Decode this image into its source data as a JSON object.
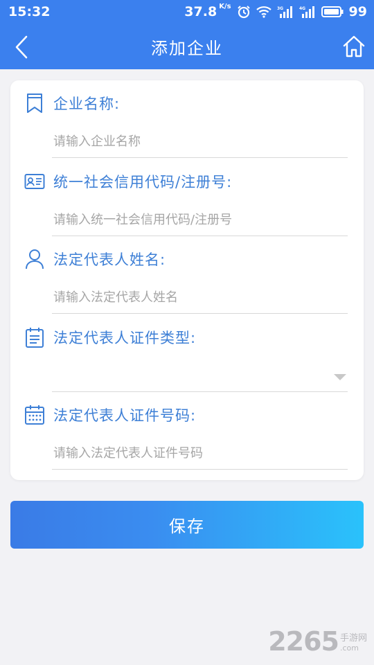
{
  "status_bar": {
    "time": "15:32",
    "net_speed": "37.8",
    "net_speed_unit": "K/s",
    "battery": "99",
    "icons": [
      "alarm-icon",
      "wifi-icon",
      "signal-3g-icon",
      "signal-4g-icon",
      "battery-icon"
    ]
  },
  "navbar": {
    "title": "添加企业",
    "back_icon": "chevron-left-icon",
    "home_icon": "home-icon"
  },
  "form": {
    "fields": [
      {
        "label": "企业名称:",
        "placeholder": "请输入企业名称",
        "icon": "bookmark-icon",
        "value": ""
      },
      {
        "label": "统一社会信用代码/注册号:",
        "placeholder": "请输入统一社会信用代码/注册号",
        "icon": "id-card-icon",
        "value": ""
      },
      {
        "label": "法定代表人姓名:",
        "placeholder": "请输入法定代表人姓名",
        "icon": "person-icon",
        "value": ""
      },
      {
        "label": "法定代表人证件类型:",
        "placeholder": "",
        "icon": "clipboard-list-icon",
        "value": ""
      },
      {
        "label": "法定代表人证件号码:",
        "placeholder": "请输入法定代表人证件号码",
        "icon": "calendar-icon",
        "value": ""
      }
    ]
  },
  "save_button": {
    "label": "保存"
  },
  "watermark": {
    "number": "2265",
    "text": "手游网",
    "domain": ".com"
  },
  "colors": {
    "header": "#3b80ee",
    "label": "#3d7fd6",
    "button_start": "#3a7be6",
    "button_end": "#2ac2fb"
  }
}
